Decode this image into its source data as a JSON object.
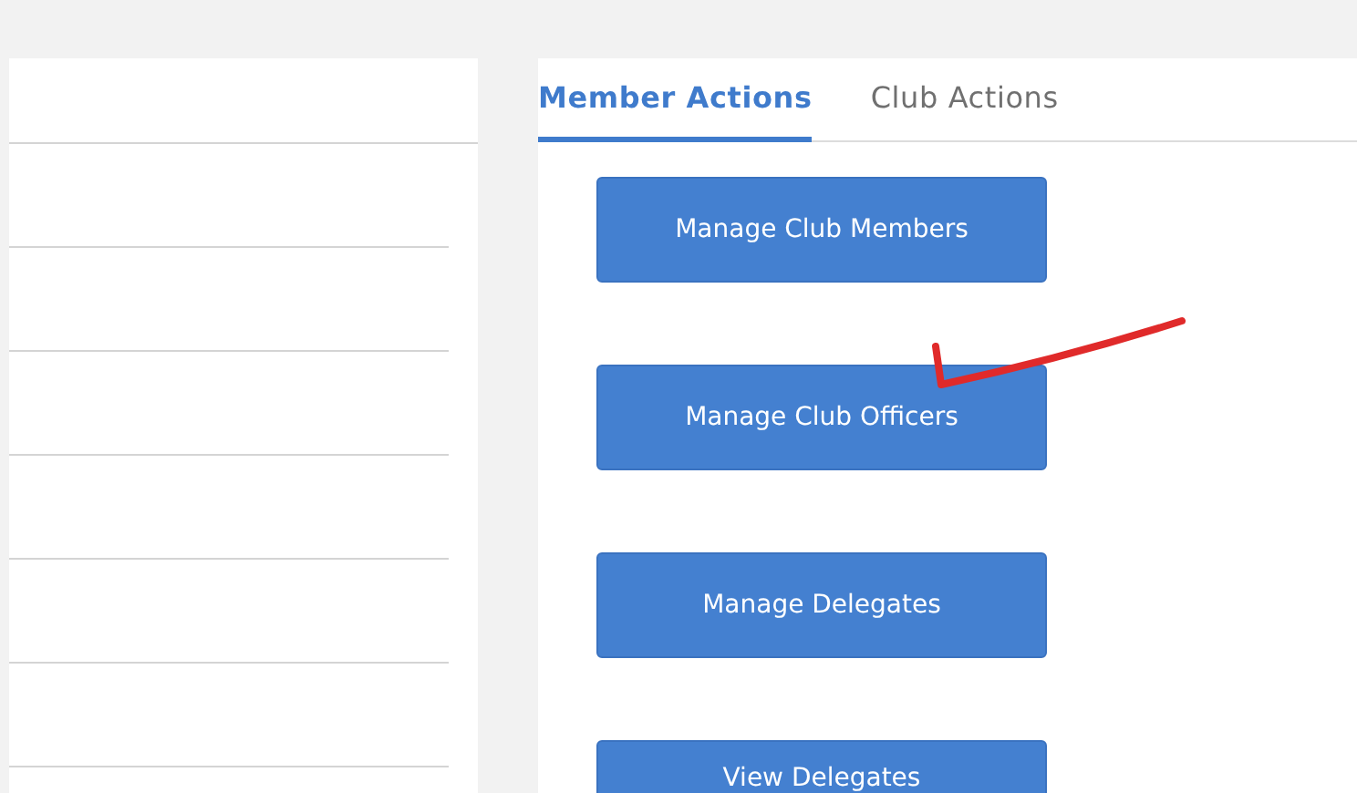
{
  "tabs": [
    {
      "label": "Member Actions",
      "selected": true
    },
    {
      "label": "Club Actions",
      "selected": false
    }
  ],
  "buttons": [
    "Manage Club Members",
    "Manage Club Officers",
    "Manage Delegates",
    "View Delegates"
  ]
}
